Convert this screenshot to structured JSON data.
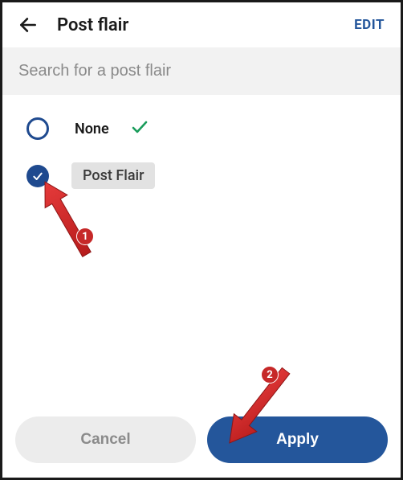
{
  "header": {
    "title": "Post flair",
    "edit": "EDIT"
  },
  "search": {
    "placeholder": "Search for a post flair",
    "value": ""
  },
  "options": {
    "none_label": "None",
    "selected_label": "Post Flair"
  },
  "footer": {
    "cancel": "Cancel",
    "apply": "Apply"
  },
  "annotations": {
    "badge1": "1",
    "badge2": "2"
  }
}
